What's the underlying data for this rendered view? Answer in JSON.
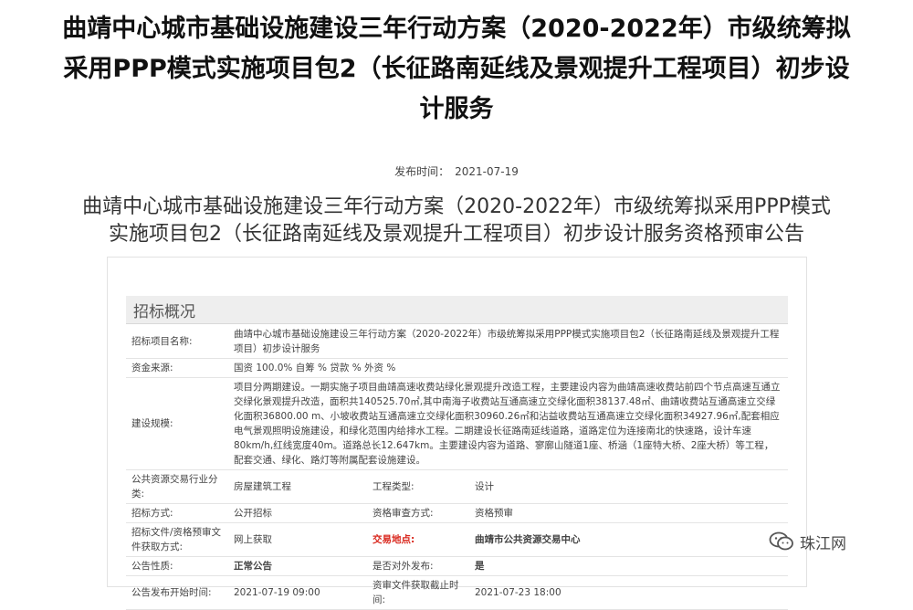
{
  "main_title_lines": [
    "曲靖中心城市基础设施建设三年行动方案（2020-2022年）市级统筹拟",
    "采用PPP模式实施项目包2（长征路南延线及景观提升工程项目）初步设",
    "计服务"
  ],
  "publish": {
    "label": "发布时间：",
    "date": "2021-07-19"
  },
  "sub_title_lines": [
    "曲靖中心城市基础设施建设三年行动方案（2020-2022年）市级统筹拟采用PPP模式",
    "实施项目包2（长征路南延线及景观提升工程项目）初步设计服务资格预审公告"
  ],
  "section": {
    "heading": "招标概况"
  },
  "rows": {
    "project_name": {
      "label": "招标项目名称:",
      "value": "曲靖中心城市基础设施建设三年行动方案（2020-2022年）市级统筹拟采用PPP模式实施项目包2（长征路南延线及景观提升工程项目）初步设计服务"
    },
    "fund_source": {
      "label": "资金来源:",
      "value": "国资 100.0% 自筹 % 贷款 % 外资 %"
    },
    "scale": {
      "label": "建设规模:",
      "value": "项目分两期建设。一期实施子项目曲靖高速收费站绿化景观提升改造工程，主要建设内容为曲靖高速收费站前四个节点高速互通立交绿化景观提升改造，面积共140525.70㎡,其中南海子收费站互通高速立交绿化面积38137.48㎡、曲靖收费站互通高速立交绿化面积36800.00 m、小坡收费站互通高速立交绿化面积30960.26㎡和沾益收费站互通高速立交绿化面积34927.96㎡,配套相应电气景观照明设施建设，和绿化范围内给排水工程。二期建设长征路南延线道路，道路定位为连接南北的快速路，设计车速80km/h,红线宽度40m。道路总长12.647km。主要建设内容为道路、寥廓山隧道1座、桥涵（1座特大桥、2座大桥）等工程，配套交通、绿化、路灯等附属配套设施建设。"
    },
    "industry": {
      "label": "公共资源交易行业分类:",
      "value": "房屋建筑工程",
      "label2": "工程类型:",
      "value2": "设计"
    },
    "method": {
      "label": "招标方式:",
      "value": "公开招标",
      "label2": "资格审查方式:",
      "value2": "资格预审"
    },
    "file_method": {
      "label": "招标文件/资格预审文件获取方式:",
      "value": "网上获取",
      "label2": "交易地点:",
      "value2": "曲靖市公共资源交易中心"
    },
    "nature": {
      "label": "公告性质:",
      "value": "正常公告",
      "label2": "是否对外发布:",
      "value2": "是"
    },
    "start_time": {
      "label": "公告发布开始时间:",
      "value": "2021-07-19 09:00",
      "label2": "资审文件获取截止时间:",
      "value2": "2021-07-23 18:00"
    }
  },
  "watermark": {
    "text": "珠江网",
    "icon": "wechat-icon"
  },
  "colors": {
    "accent_red": "#d9261c"
  }
}
